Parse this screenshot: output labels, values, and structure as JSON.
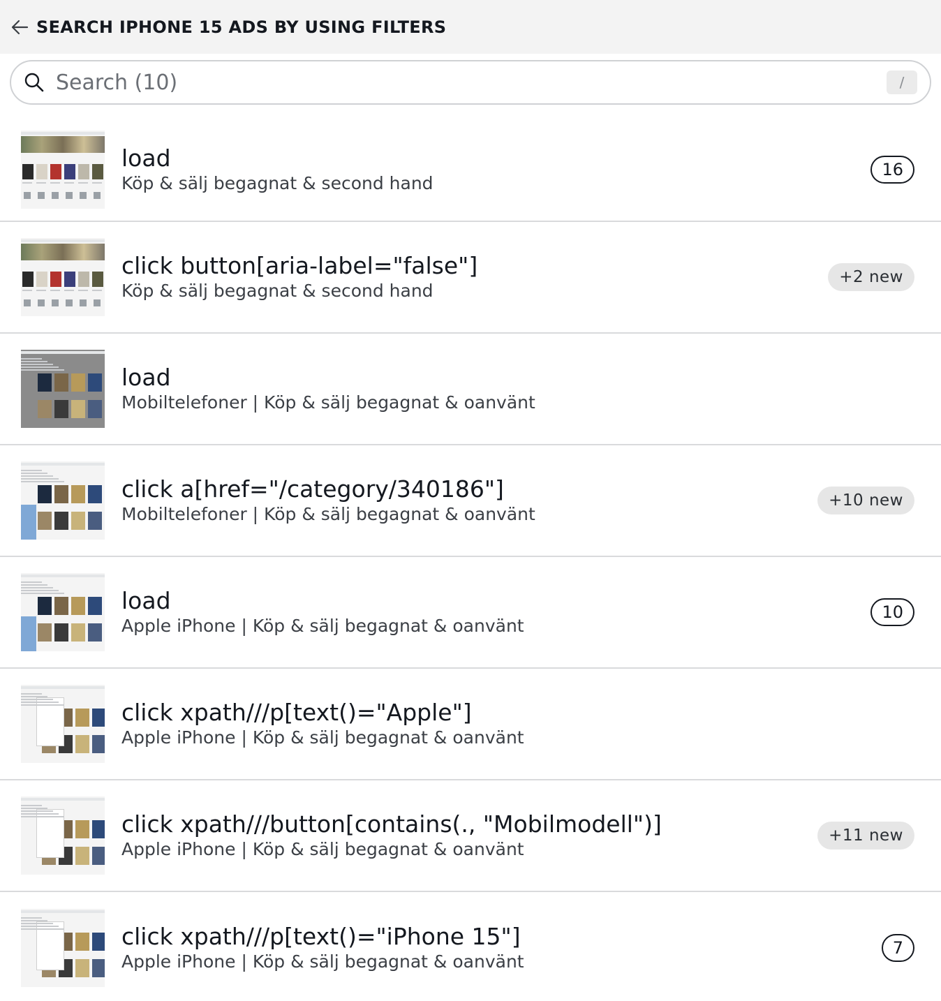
{
  "header": {
    "title": "SEARCH IPHONE 15 ADS BY USING FILTERS",
    "back_icon": "arrow-left-icon"
  },
  "search": {
    "placeholder": "Search (10)",
    "shortcut": "/",
    "icon": "search-icon"
  },
  "steps": [
    {
      "action": "load",
      "page": "Köp & sälj begagnat & second hand",
      "badge_type": "count",
      "badge": "16",
      "thumb": "home"
    },
    {
      "action": "click button[aria-label=\"false\"]",
      "page": "Köp & sälj begagnat & second hand",
      "badge_type": "new",
      "badge": "+2 new",
      "thumb": "home"
    },
    {
      "action": "load",
      "page": "Mobiltelefoner | Köp & sälj begagnat & oanvänt",
      "badge_type": "none",
      "badge": "",
      "thumb": "dim"
    },
    {
      "action": "click a[href=\"/category/340186\"]",
      "page": "Mobiltelefoner | Köp & sälj begagnat & oanvänt",
      "badge_type": "new",
      "badge": "+10 new",
      "thumb": "list"
    },
    {
      "action": "load",
      "page": "Apple iPhone | Köp & sälj begagnat & oanvänt",
      "badge_type": "count",
      "badge": "10",
      "thumb": "list"
    },
    {
      "action": "click xpath///p[text()=\"Apple\"]",
      "page": "Apple iPhone | Köp & sälj begagnat & oanvänt",
      "badge_type": "none",
      "badge": "",
      "thumb": "menu"
    },
    {
      "action": "click xpath///button[contains(., \"Mobilmodell\")]",
      "page": "Apple iPhone | Köp & sälj begagnat & oanvänt",
      "badge_type": "new",
      "badge": "+11 new",
      "thumb": "menu"
    },
    {
      "action": "click xpath///p[text()=\"iPhone 15\"]",
      "page": "Apple iPhone | Köp & sälj begagnat & oanvänt",
      "badge_type": "count",
      "badge": "7",
      "thumb": "menu"
    }
  ]
}
